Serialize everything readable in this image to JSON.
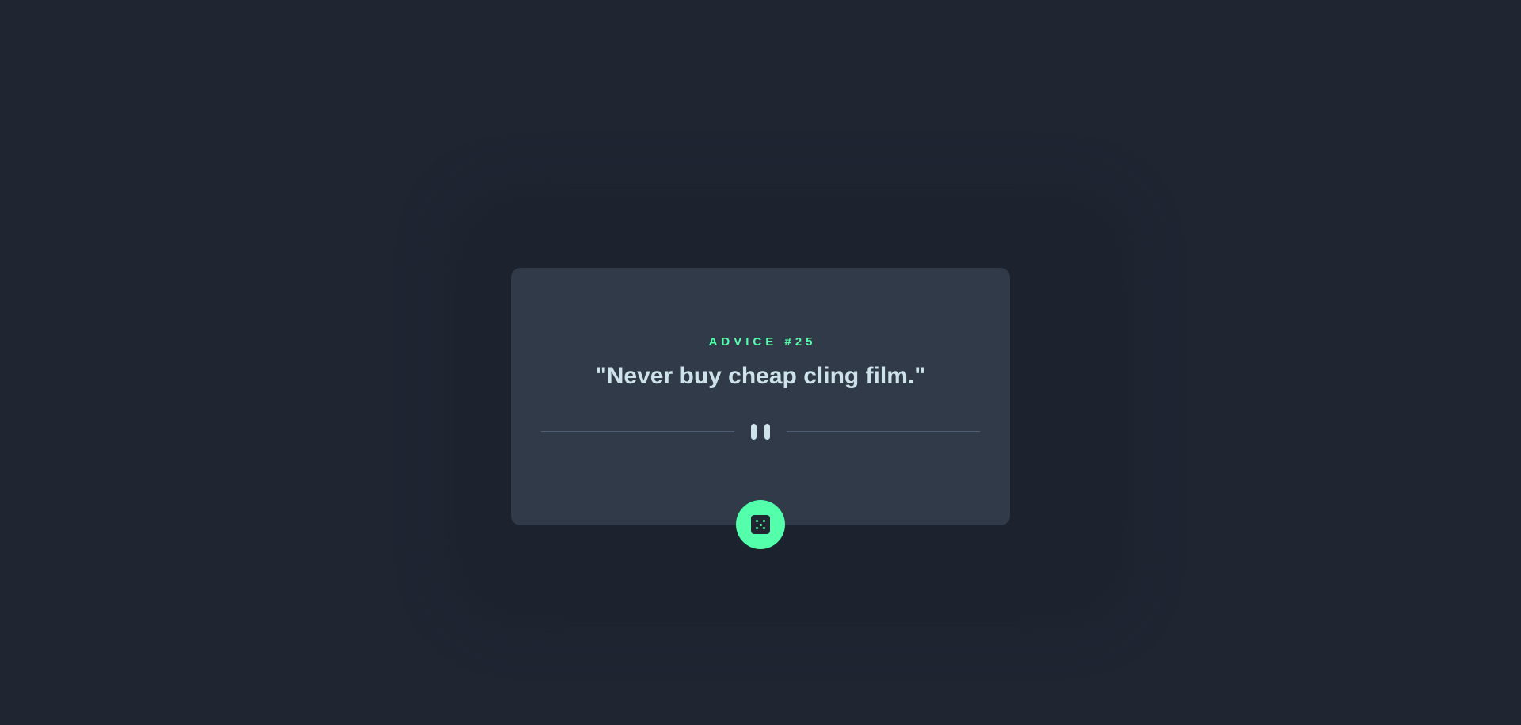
{
  "advice": {
    "label": "ADVICE #25",
    "text": "\"Never buy cheap cling film.\""
  },
  "divider": {
    "icon": "pause-icon"
  },
  "dice_button": {
    "icon": "dice-icon"
  },
  "colors": {
    "background": "#1f2632",
    "card": "#313a49",
    "accent": "#53ffaa",
    "text": "#cee3e9",
    "divider": "#4f5d74"
  }
}
